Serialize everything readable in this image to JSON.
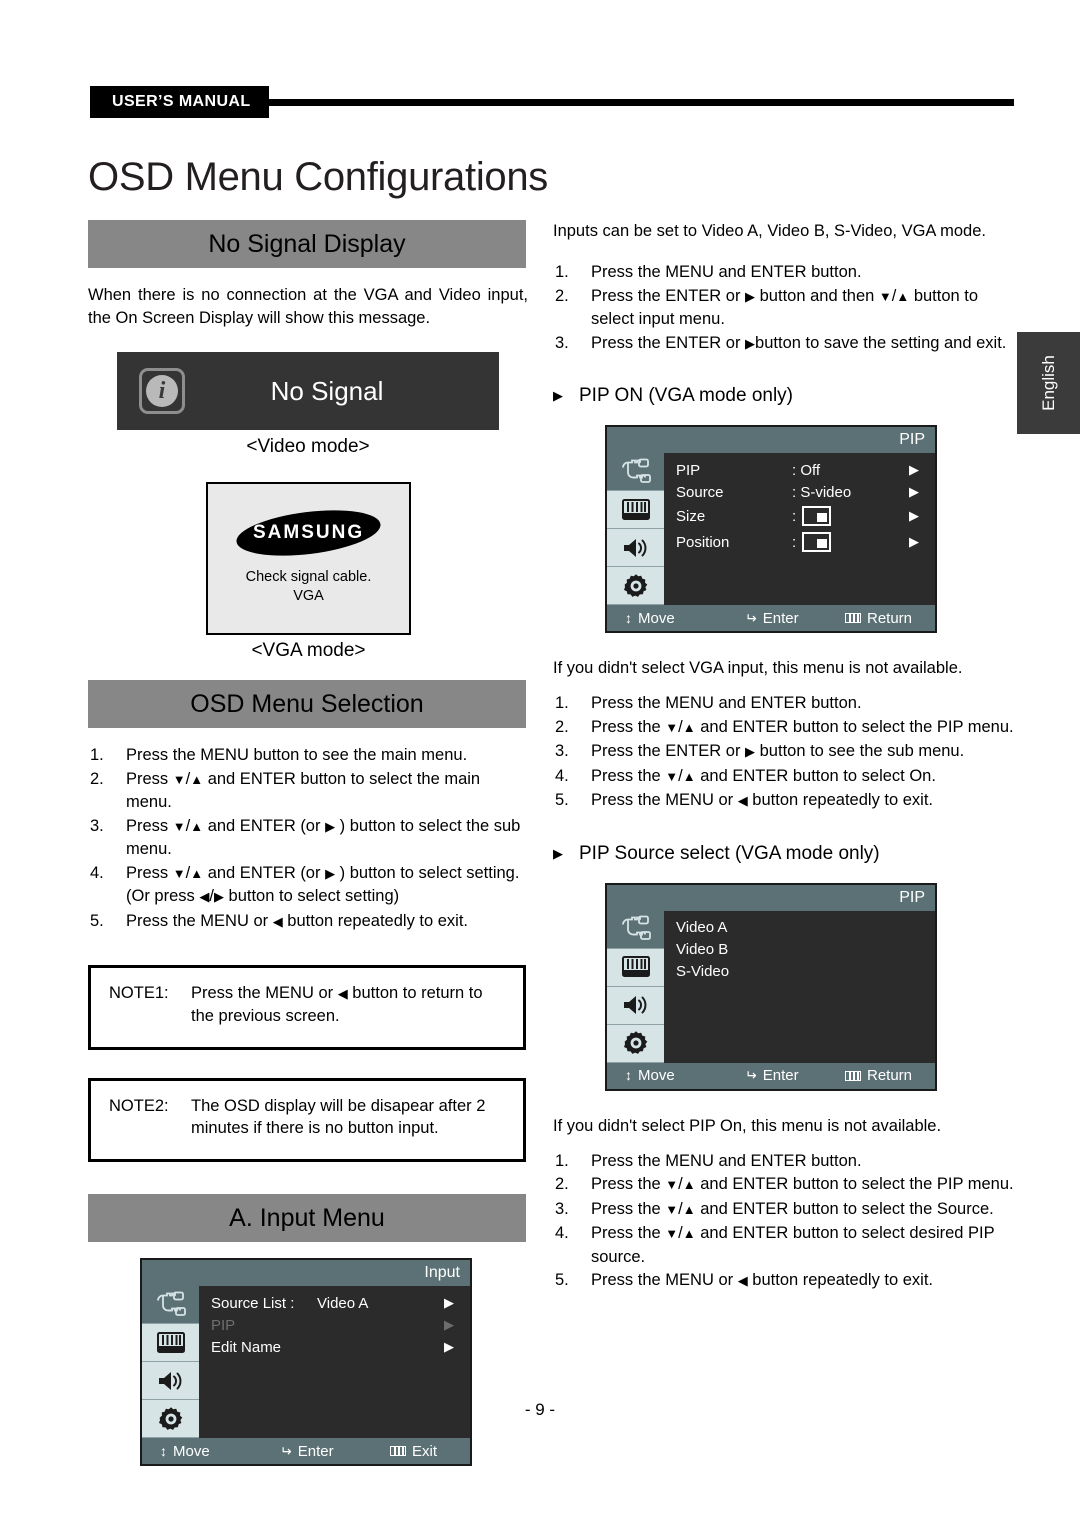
{
  "header": {
    "manual_tag": "USER’S MANUAL"
  },
  "page_title": "OSD Menu Configurations",
  "lang_tab": "English",
  "page_number": "- 9 -",
  "left": {
    "section1": {
      "bar_title": "No Signal Display",
      "intro": "When there is no connection at the VGA and Video input, the On Screen Display will show this message.",
      "nosignal_box": {
        "icon": "info-icon",
        "text": "No Signal",
        "caption": "<Video mode>"
      },
      "vga_box": {
        "logo": "SAMSUNG",
        "line1": "Check signal cable.",
        "line2": "VGA",
        "caption": "<VGA mode>"
      }
    },
    "section2": {
      "bar_title": "OSD Menu Selection",
      "steps": [
        {
          "num": "1.",
          "parts": [
            {
              "t": "Press the MENU button to see the main menu."
            }
          ]
        },
        {
          "num": "2.",
          "parts": [
            {
              "t": "Press "
            },
            {
              "g": "tri-d"
            },
            {
              "t": "/"
            },
            {
              "g": "tri-u"
            },
            {
              "t": " and ENTER button to select the main menu."
            }
          ]
        },
        {
          "num": "3.",
          "parts": [
            {
              "t": "Press "
            },
            {
              "g": "tri-d"
            },
            {
              "t": "/"
            },
            {
              "g": "tri-u"
            },
            {
              "t": " and ENTER (or "
            },
            {
              "g": "tri-r"
            },
            {
              "t": " ) button to select the sub menu."
            }
          ]
        },
        {
          "num": "4.",
          "parts": [
            {
              "t": "Press "
            },
            {
              "g": "tri-d"
            },
            {
              "t": "/"
            },
            {
              "g": "tri-u"
            },
            {
              "t": " and ENTER (or "
            },
            {
              "g": "tri-r"
            },
            {
              "t": " ) button to select setting. (Or press "
            },
            {
              "g": "tri-l"
            },
            {
              "t": "/"
            },
            {
              "g": "tri-r"
            },
            {
              "t": " button to select setting)"
            }
          ]
        },
        {
          "num": "5.",
          "parts": [
            {
              "t": "Press the MENU or "
            },
            {
              "g": "tri-l"
            },
            {
              "t": " button repeatedly to exit."
            }
          ]
        }
      ]
    },
    "note1": {
      "label": "NOTE1:",
      "parts": [
        {
          "t": "Press the MENU or "
        },
        {
          "g": "tri-l"
        },
        {
          "t": " button to return to the previous screen."
        }
      ]
    },
    "note2": {
      "label": "NOTE2:",
      "parts": [
        {
          "t": "The OSD display will be disapear after 2 minutes if there is no button input."
        }
      ]
    },
    "section3": {
      "bar_title": "A. Input Menu",
      "osd": {
        "title": "Input",
        "rail_icons": [
          "input-source-icon",
          "picture-icon",
          "sound-icon",
          "setup-icon"
        ],
        "rows": [
          {
            "label": "Source List :",
            "value": "Video A",
            "arrow": "▶",
            "dim": false
          },
          {
            "label": "PIP",
            "value": "",
            "arrow": "▶",
            "dim": true
          },
          {
            "label": "Edit Name",
            "value": "",
            "arrow": "▶",
            "dim": false
          }
        ],
        "foot": {
          "move": "Move",
          "enter": "Enter",
          "exit": "Exit"
        }
      }
    }
  },
  "right": {
    "intro": "Inputs can be set to Video A, Video B, S-Video, VGA mode.",
    "steps_input": [
      {
        "num": "1.",
        "parts": [
          {
            "t": "Press the MENU and ENTER button."
          }
        ]
      },
      {
        "num": "2.",
        "parts": [
          {
            "t": "Press the ENTER or "
          },
          {
            "g": "tri-r"
          },
          {
            "t": " button and then "
          },
          {
            "g": "tri-d"
          },
          {
            "t": "/"
          },
          {
            "g": "tri-u"
          },
          {
            "t": " button to select input menu."
          }
        ]
      },
      {
        "num": "3.",
        "parts": [
          {
            "t": "Press the ENTER or "
          },
          {
            "g": "tri-r"
          },
          {
            "t": "button to save the setting and exit."
          }
        ]
      }
    ],
    "pip_on_heading": "PIP ON (VGA mode only)",
    "osd_pip": {
      "title": "PIP",
      "rail_icons": [
        "input-source-icon",
        "picture-icon",
        "sound-icon",
        "setup-icon"
      ],
      "rows": [
        {
          "label": "PIP",
          "value": ": Off",
          "arrow": "▶",
          "box": false
        },
        {
          "label": "Source",
          "value": ": S-video",
          "arrow": "▶",
          "box": false
        },
        {
          "label": "Size",
          "value": ":",
          "arrow": "▶",
          "box": true
        },
        {
          "label": "Position",
          "value": ":",
          "arrow": "▶",
          "box": true
        }
      ],
      "foot": {
        "move": "Move",
        "enter": "Enter",
        "exit": "Return"
      }
    },
    "pip_on_note": "If you didn't select VGA input, this menu is not available.",
    "steps_pip_on": [
      {
        "num": "1.",
        "parts": [
          {
            "t": "Press the MENU and ENTER button."
          }
        ]
      },
      {
        "num": "2.",
        "parts": [
          {
            "t": "Press the "
          },
          {
            "g": "tri-d"
          },
          {
            "t": "/"
          },
          {
            "g": "tri-u"
          },
          {
            "t": " and ENTER button to select the PIP menu."
          }
        ]
      },
      {
        "num": "3.",
        "parts": [
          {
            "t": "Press the ENTER or "
          },
          {
            "g": "tri-r"
          },
          {
            "t": " button to see the sub menu."
          }
        ]
      },
      {
        "num": "4.",
        "parts": [
          {
            "t": "Press the "
          },
          {
            "g": "tri-d"
          },
          {
            "t": "/"
          },
          {
            "g": "tri-u"
          },
          {
            "t": " and ENTER button to select On."
          }
        ]
      },
      {
        "num": "5.",
        "parts": [
          {
            "t": "Press the MENU or "
          },
          {
            "g": "tri-l"
          },
          {
            "t": " button repeatedly to exit."
          }
        ]
      }
    ],
    "pip_source_heading": "PIP Source select (VGA mode only)",
    "osd_pip_source": {
      "title": "PIP",
      "rail_icons": [
        "input-source-icon",
        "picture-icon",
        "sound-icon",
        "setup-icon"
      ],
      "rows": [
        {
          "label": "Video A"
        },
        {
          "label": "Video B"
        },
        {
          "label": "S-Video"
        }
      ],
      "foot": {
        "move": "Move",
        "enter": "Enter",
        "exit": "Return"
      }
    },
    "pip_source_note": "If you didn't select PIP On, this menu is not available.",
    "steps_pip_source": [
      {
        "num": "1.",
        "parts": [
          {
            "t": "Press the MENU and ENTER button."
          }
        ]
      },
      {
        "num": "2.",
        "parts": [
          {
            "t": "Press  the "
          },
          {
            "g": "tri-d"
          },
          {
            "t": "/"
          },
          {
            "g": "tri-u"
          },
          {
            "t": " and ENTER button to select the PIP menu."
          }
        ]
      },
      {
        "num": "3.",
        "parts": [
          {
            "t": "Press the "
          },
          {
            "g": "tri-d"
          },
          {
            "t": "/"
          },
          {
            "g": "tri-u"
          },
          {
            "t": " and ENTER button  to select the Source."
          }
        ]
      },
      {
        "num": "4.",
        "parts": [
          {
            "t": "Press the "
          },
          {
            "g": "tri-d"
          },
          {
            "t": "/"
          },
          {
            "g": "tri-u"
          },
          {
            "t": " and ENTER button  to select desired PIP source."
          }
        ]
      },
      {
        "num": "5.",
        "parts": [
          {
            "t": "Press the MENU or "
          },
          {
            "g": "tri-l"
          },
          {
            "t": " button repeatedly to exit."
          }
        ]
      }
    ]
  },
  "colors": {
    "section_bar": "#878787",
    "osd_bg": "#2b2b2b",
    "osd_accent": "#5c7175",
    "osd_rail": "#d6e4e6",
    "header_tag": "#000000"
  }
}
